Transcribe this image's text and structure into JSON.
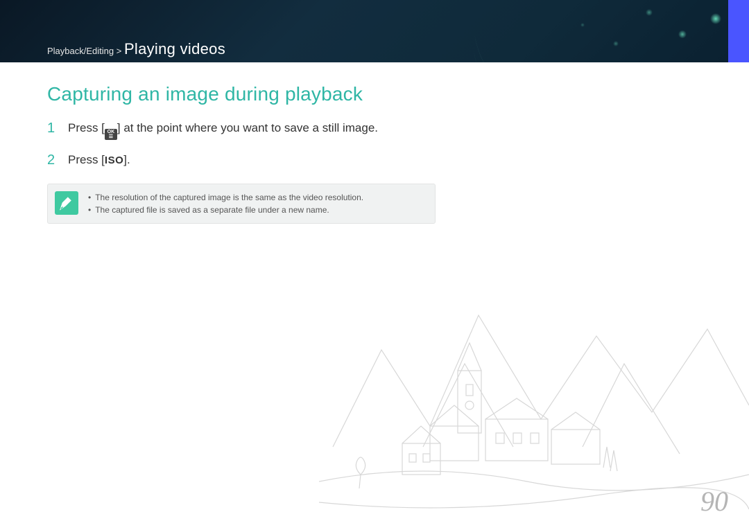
{
  "header": {
    "breadcrumb_prefix": "Playback/Editing > ",
    "breadcrumb_current": "Playing videos"
  },
  "heading": "Capturing an image during playback",
  "steps": [
    {
      "num": "1",
      "text_before": "Press [",
      "icon_line1": "OK",
      "icon_line2": "☰",
      "text_after": "] at the point where you want to save a still image."
    },
    {
      "num": "2",
      "text_before": "Press [",
      "iso": "ISO",
      "text_after": "]."
    }
  ],
  "notes": [
    "The resolution of the captured image is the same as the video resolution.",
    "The captured file is saved as a separate file under a new name."
  ],
  "page_number": "90"
}
